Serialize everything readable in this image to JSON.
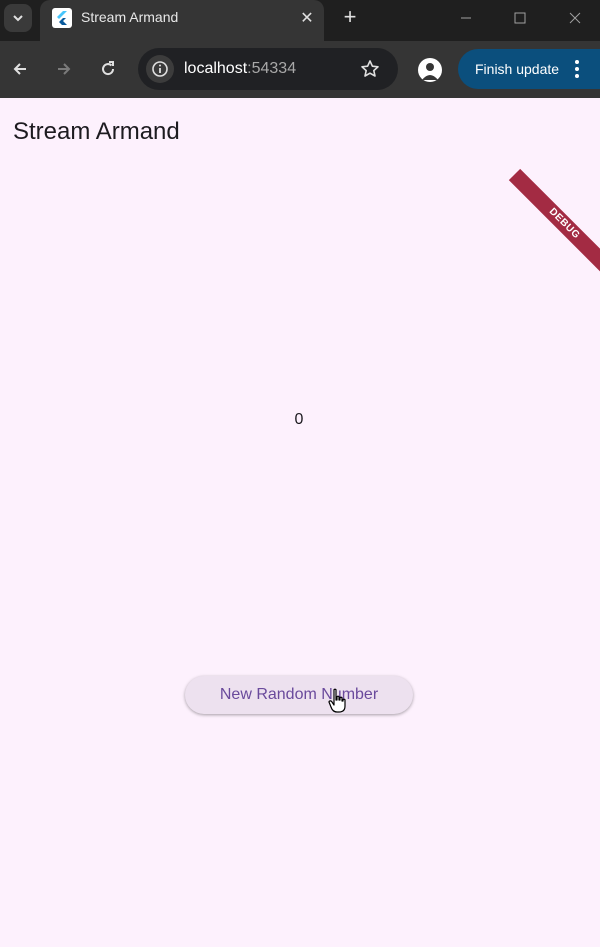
{
  "browser": {
    "tab_title": "Stream Armand",
    "url_host": "localhost",
    "url_port": ":54334",
    "update_label": "Finish update"
  },
  "app": {
    "title": "Stream Armand",
    "value": "0",
    "button_label": "New Random Number",
    "debug_label": "DEBUG"
  },
  "colors": {
    "background": "#fdf1fd",
    "button_bg": "#ede1ef",
    "button_text": "#6a4a9c",
    "debug_banner": "#a32b43",
    "update_button": "#0b4f7d"
  }
}
